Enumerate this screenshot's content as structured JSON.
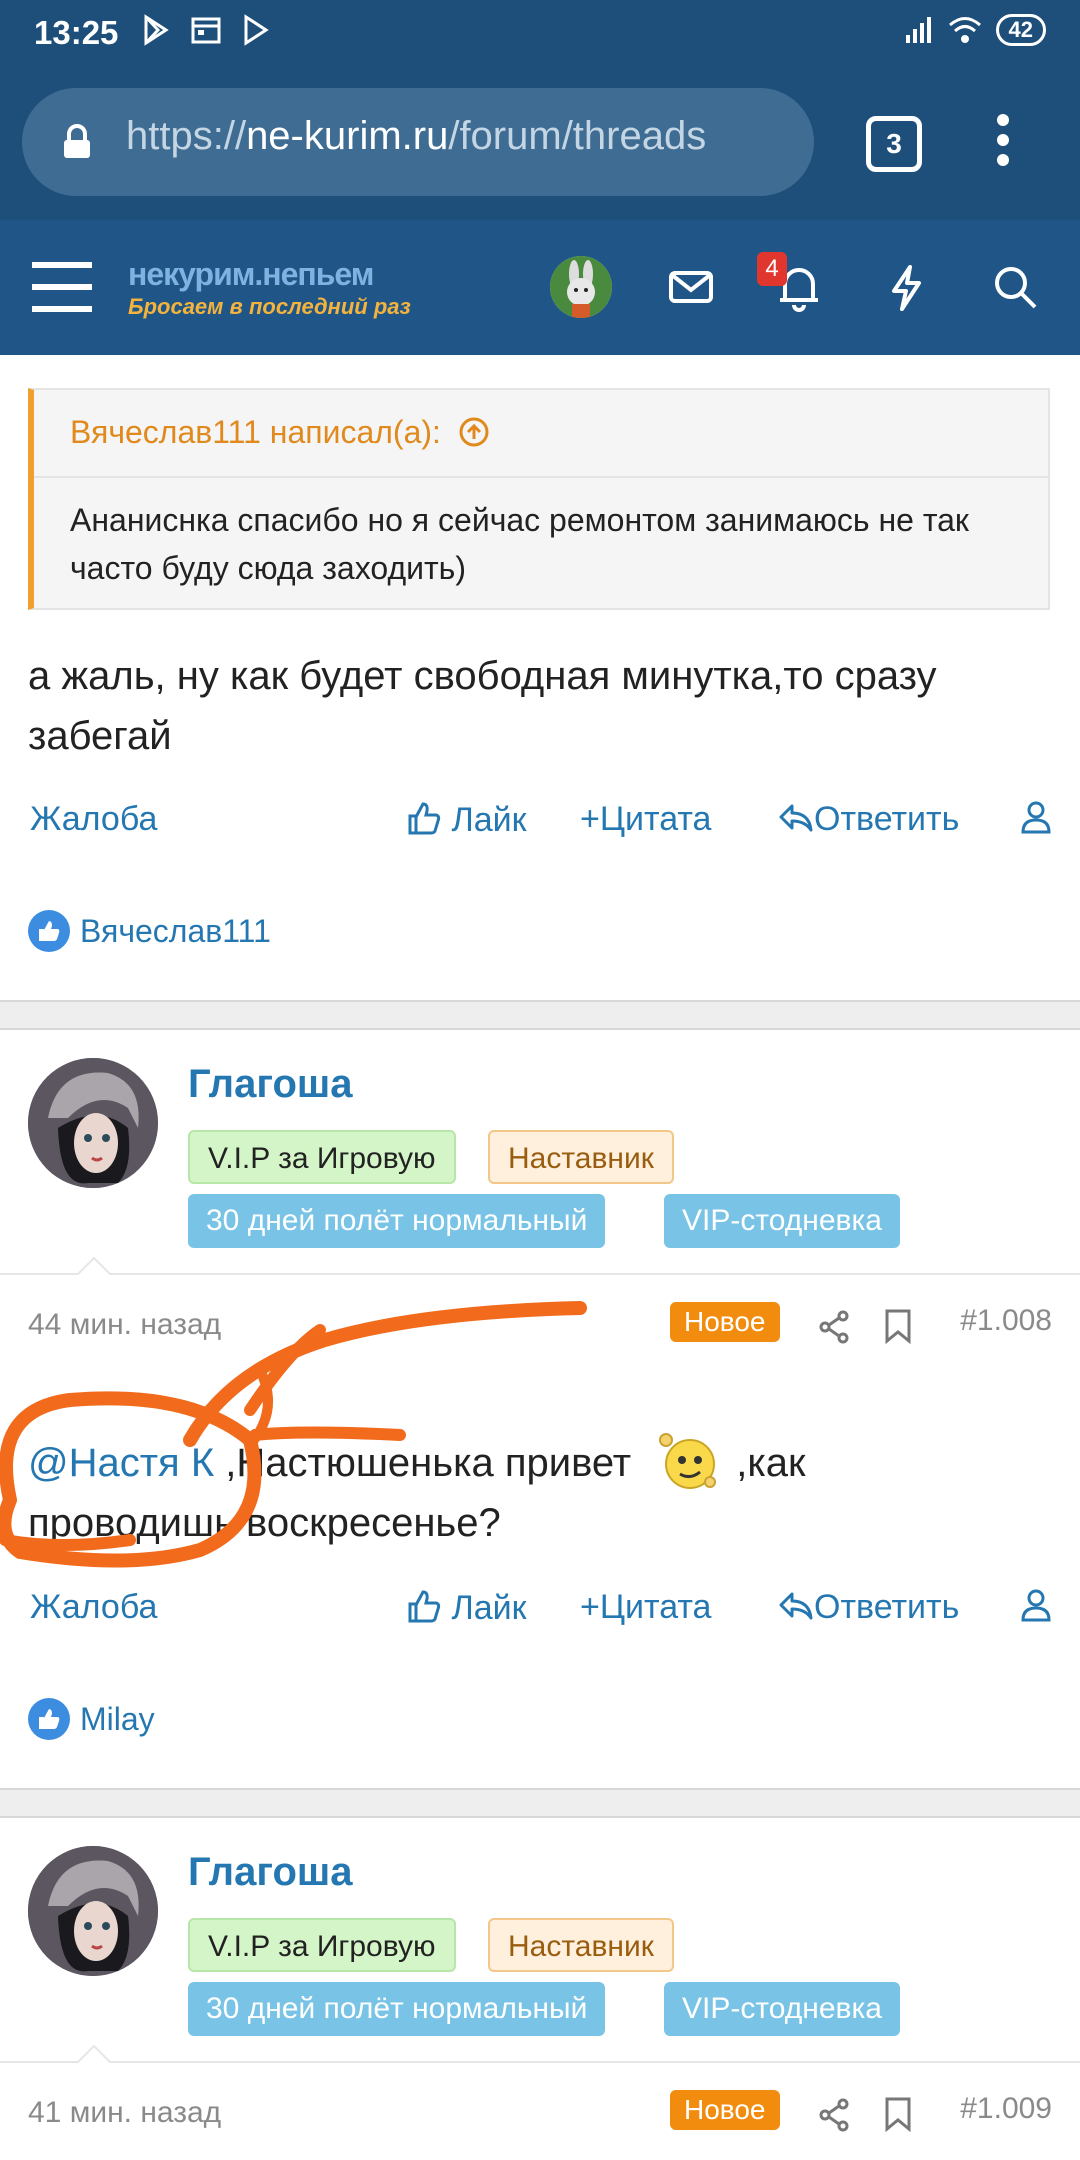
{
  "status_bar": {
    "time": "13:25",
    "battery": "42"
  },
  "browser": {
    "url_prefix": "https://",
    "url_domain": "ne-kurim.ru",
    "url_path": "/forum/threads",
    "tab_count": "3"
  },
  "site": {
    "logo_main": "некурим.непьем",
    "logo_sub": "Бросаем в последний раз",
    "notification_count": "4"
  },
  "colors": {
    "header": "#1f5687",
    "link": "#2577b1",
    "accent": "#f28c0e"
  },
  "posts": [
    {
      "quote_author": "Вячеслав111 написал(а):",
      "quote_text": "Ананиснка спасибо но я сейчас ремонтом занимаюсь не так часто буду сюда заходить)",
      "text": "а жаль, ну как будет свободная минутка,то сразу забегай",
      "likers": "Вячеслав111"
    },
    {
      "author": "Глагоша",
      "badges": [
        "V.I.P за Игровую",
        "Наставник",
        "30 дней полёт нормальный",
        "VIP-стодневка"
      ],
      "time": "44 мин. назад",
      "new_label": "Новое",
      "number": "#1.008",
      "mention": "@Настя К",
      "text_a": " ,Настюшенька привет",
      "text_b": ",как",
      "text_c": "проводишь воскресенье?",
      "likers": "Milay"
    },
    {
      "author": "Глагоша",
      "badges": [
        "V.I.P за Игровую",
        "Наставник",
        "30 дней полёт нормальный",
        "VIP-стодневка"
      ],
      "time": "41 мин. назад",
      "new_label": "Новое",
      "number": "#1.009"
    }
  ],
  "actions": {
    "report": "Жалоба",
    "like": "Лайк",
    "quote": "Цитата",
    "reply": "Ответить"
  }
}
